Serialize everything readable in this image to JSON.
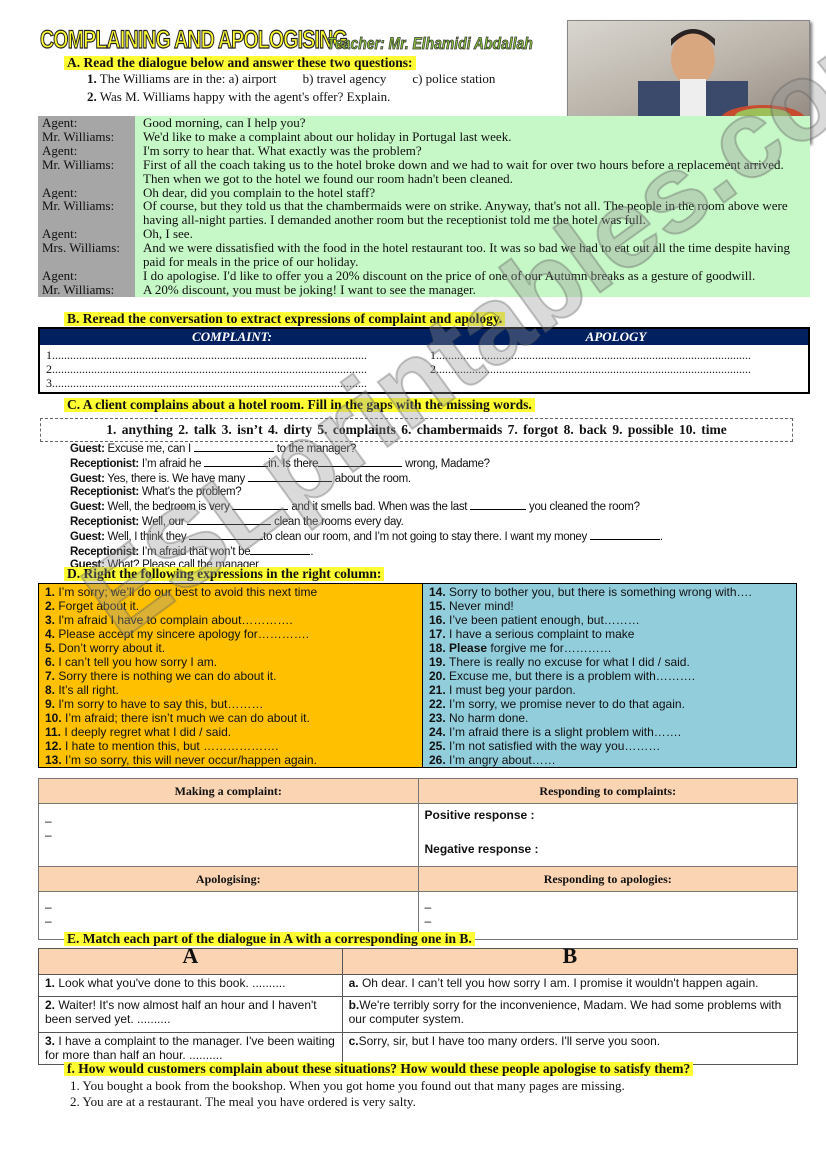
{
  "header": {
    "title": "COMPLAINING AND APOLOGISING",
    "teacher": "Teacher: Mr. Elhamidi Abdallah"
  },
  "photo": {
    "icon": "man-with-plate-photo"
  },
  "sectionA": {
    "heading": "A.   Read the dialogue below and answer these two questions:",
    "q1_num": "1.",
    "q1": "The Williams are in the: a) airport        b) travel agency        c) police station",
    "q2_num": "2.",
    "q2": "Was M. Williams happy with the agent's offer? Explain."
  },
  "dialogue": [
    {
      "speaker": "Agent:",
      "text": "Good morning, can I help you?"
    },
    {
      "speaker": "Mr. Williams:",
      "text": "We'd like to make a complaint about our holiday in Portugal last week."
    },
    {
      "speaker": "Agent:",
      "text": "I'm sorry to hear that. What exactly was the problem?"
    },
    {
      "speaker": "Mr. Williams:",
      "text": "First of all the coach taking us to the hotel broke down and we had to wait for over two hours before a replacement arrived. Then when we got to the hotel we found our room hadn't been cleaned."
    },
    {
      "speaker": "Agent:",
      "text": "Oh dear, did you complain to the hotel staff?"
    },
    {
      "speaker": "Mr. Williams:",
      "text": "Of course, but they told us that the chambermaids were on strike. Anyway, that's not all. The people in the room above were having all-night parties. I demanded another room but the receptionist told me the hotel was full."
    },
    {
      "speaker": "Agent:",
      "text": "Oh, I see."
    },
    {
      "speaker": "Mrs. Williams:",
      "text": "And we were dissatisfied with the food in the hotel restaurant too. It was so bad we had to eat out all the time despite having paid for meals in the price of our holiday."
    },
    {
      "speaker": "Agent:",
      "text": "I do apologise. I'd like to offer you a 20% discount on the price of one of our Autumn breaks as a gesture of goodwill."
    },
    {
      "speaker": "Mr. Williams:",
      "text": "A 20% discount, you must be joking! I want to see the manager."
    }
  ],
  "sectionB": {
    "heading": "B.   Reread the conversation to extract expressions of complaint and apology.",
    "col1": "COMPLAINT:",
    "col2": "APOLOGY",
    "left": [
      "1.........................................................................................................",
      "2.........................................................................................................",
      "3........................................................................................................."
    ],
    "right": [
      "1.........................................................................................................",
      "2........................................................................................................."
    ]
  },
  "sectionC": {
    "heading": "C.   A client complains about a hotel room. Fill in the gaps with the missing words.",
    "words": "1. anything   2. talk   3. isn’t   4. dirty   5. complaints   6. chambermaids   7. forgot   8. back   9. possible   10. time",
    "lines": [
      {
        "sp": "Guest:",
        "a": " Excuse me, can I ",
        "b": " to the manager?"
      },
      {
        "sp": "Receptionist:",
        "a": " I’m afraid he ",
        "b": "in. Is there",
        "c": " wrong, Madame?"
      },
      {
        "sp": "Guest:",
        "a": " Yes, there is. We have many ",
        "b": " about the room."
      },
      {
        "sp": "Receptionist:",
        "a": " What’s the problem?"
      },
      {
        "sp": "Guest:",
        "a": " Well, the bedroom is very ",
        "b": " and it  smells bad. When was the last ",
        "c": " you cleaned the room?"
      },
      {
        "sp": "Receptionist:",
        "a": " Well, our ",
        "b": " clean the rooms every day."
      },
      {
        "sp": "Guest:",
        "a": " Well, I think they ",
        "b": "to clean our room, and I’m not going to stay there. I want my money ",
        "c": "."
      },
      {
        "sp": "Receptionist:",
        "a": " I’m afraid that won’t be",
        "b": "."
      },
      {
        "sp": "Guest:",
        "a": " What? Please call the manager"
      }
    ]
  },
  "sectionD": {
    "heading": "D.   Right the following expressions in the right column:",
    "left": [
      [
        "1.",
        "I’m  sorry; we’ll do our best to avoid this next time"
      ],
      [
        "2.",
        "Forget about it."
      ],
      [
        "3.",
        "I'm afraid I have to complain about…………."
      ],
      [
        "4.",
        "Please accept my sincere apology for…………."
      ],
      [
        "5.",
        "Don’t worry about it."
      ],
      [
        "6.",
        "I can’t tell you how sorry I am."
      ],
      [
        "7.",
        "Sorry there is nothing we can do about it."
      ],
      [
        "8.",
        "It’s all right."
      ],
      [
        "9.",
        "I'm sorry to have to say this, but………"
      ],
      [
        "10.",
        "I’m afraid; there isn’t much we can do about it."
      ],
      [
        "11.",
        "I deeply regret what I did / said."
      ],
      [
        "12.",
        "I hate to mention this, but ………………."
      ],
      [
        "13.",
        "I’m so sorry, this will never occur/happen again."
      ]
    ],
    "right": [
      [
        "14.",
        "Sorry to bother you, but there is something wrong with…."
      ],
      [
        "15.",
        "Never mind!"
      ],
      [
        "16.",
        "I’ve been patient enough, but………"
      ],
      [
        "17.",
        "I have a serious complaint to make"
      ],
      [
        "18. Please",
        "forgive me for…………"
      ],
      [
        "19.",
        "There is really no excuse for what I did / said."
      ],
      [
        "20.",
        "Excuse me, but there is a problem with………."
      ],
      [
        "21.",
        "I must beg your pardon."
      ],
      [
        "22.",
        "I’m sorry, we promise never to do that again."
      ],
      [
        "23.",
        "No harm done."
      ],
      [
        "24.",
        "I’m afraid there is a slight problem with……."
      ],
      [
        "25.",
        "I’m not satisfied with the way you………"
      ],
      [
        "26.",
        "I’m angry about……"
      ]
    ]
  },
  "classify": {
    "making": "Making a complaint:",
    "responding": "Responding to complaints:",
    "positive": "Positive response :",
    "negative": "Negative response :",
    "apologising": "Apologising:",
    "resp_apol": "Responding to apologies:",
    "dash": "–"
  },
  "sectionE": {
    "heading": "E.   Match each part of the dialogue in A with a corresponding one in B.",
    "colA": "A",
    "colB": "B",
    "rows": [
      {
        "an": "1.",
        "a": "Look what you've done to this book. ..........",
        "bn": "a.",
        "b": "Oh dear. I can’t tell you how sorry I am. I promise it wouldn't happen again."
      },
      {
        "an": "2.",
        "a": "Waiter! It's now almost half an hour and I haven't been served yet. ..........",
        "bn": "b.",
        "b": "We're terribly sorry for the inconvenience, Madam. We had some problems with our computer system."
      },
      {
        "an": "3.",
        "a": "I have a complaint to the manager. I've been waiting for more than half an hour. ..........",
        "bn": "c.",
        "b": "Sorry, sir, but I have too many orders. I'll serve you soon."
      }
    ]
  },
  "sectionF": {
    "heading": "f. How would customers complain about these situations? How would these people apologise to satisfy them?",
    "items": [
      "1.  You bought a book from the bookshop. When you got home you found out that many pages are missing.",
      "2.  You are at a restaurant. The meal you have ordered is very salty."
    ]
  },
  "watermark": "ESLprintables.com"
}
